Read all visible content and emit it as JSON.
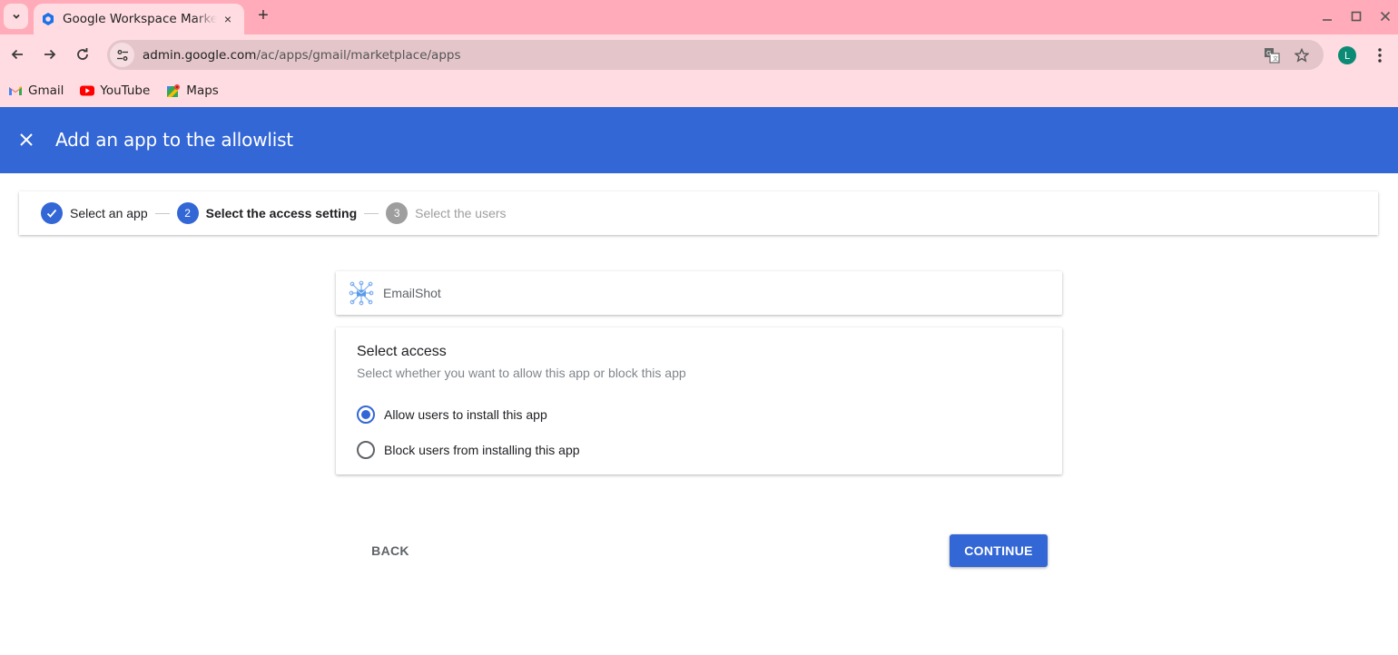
{
  "browser": {
    "tab": {
      "title": "Google Workspace Marketplace",
      "close_label": "×"
    },
    "new_tab_label": "+",
    "url_host": "admin.google.com",
    "url_path": "/ac/apps/gmail/marketplace/apps",
    "profile_initial": "L",
    "bookmarks": [
      {
        "label": "Gmail",
        "icon": "gmail-icon"
      },
      {
        "label": "YouTube",
        "icon": "youtube-icon"
      },
      {
        "label": "Maps",
        "icon": "maps-icon"
      }
    ]
  },
  "header": {
    "title": "Add an app to the allowlist",
    "color": "#3367d6"
  },
  "stepper": {
    "steps": [
      {
        "number": "1",
        "label": "Select an app",
        "state": "done"
      },
      {
        "number": "2",
        "label": "Select the access setting",
        "state": "active"
      },
      {
        "number": "3",
        "label": "Select the users",
        "state": "pending"
      }
    ]
  },
  "app": {
    "name": "EmailShot",
    "icon": "emailshot-icon"
  },
  "access": {
    "title": "Select access",
    "subtitle": "Select whether you want to allow this app or block this app",
    "options": [
      {
        "label": "Allow users to install this app",
        "checked": true
      },
      {
        "label": "Block users from installing this app",
        "checked": false
      }
    ]
  },
  "actions": {
    "back_label": "BACK",
    "continue_label": "CONTINUE"
  }
}
